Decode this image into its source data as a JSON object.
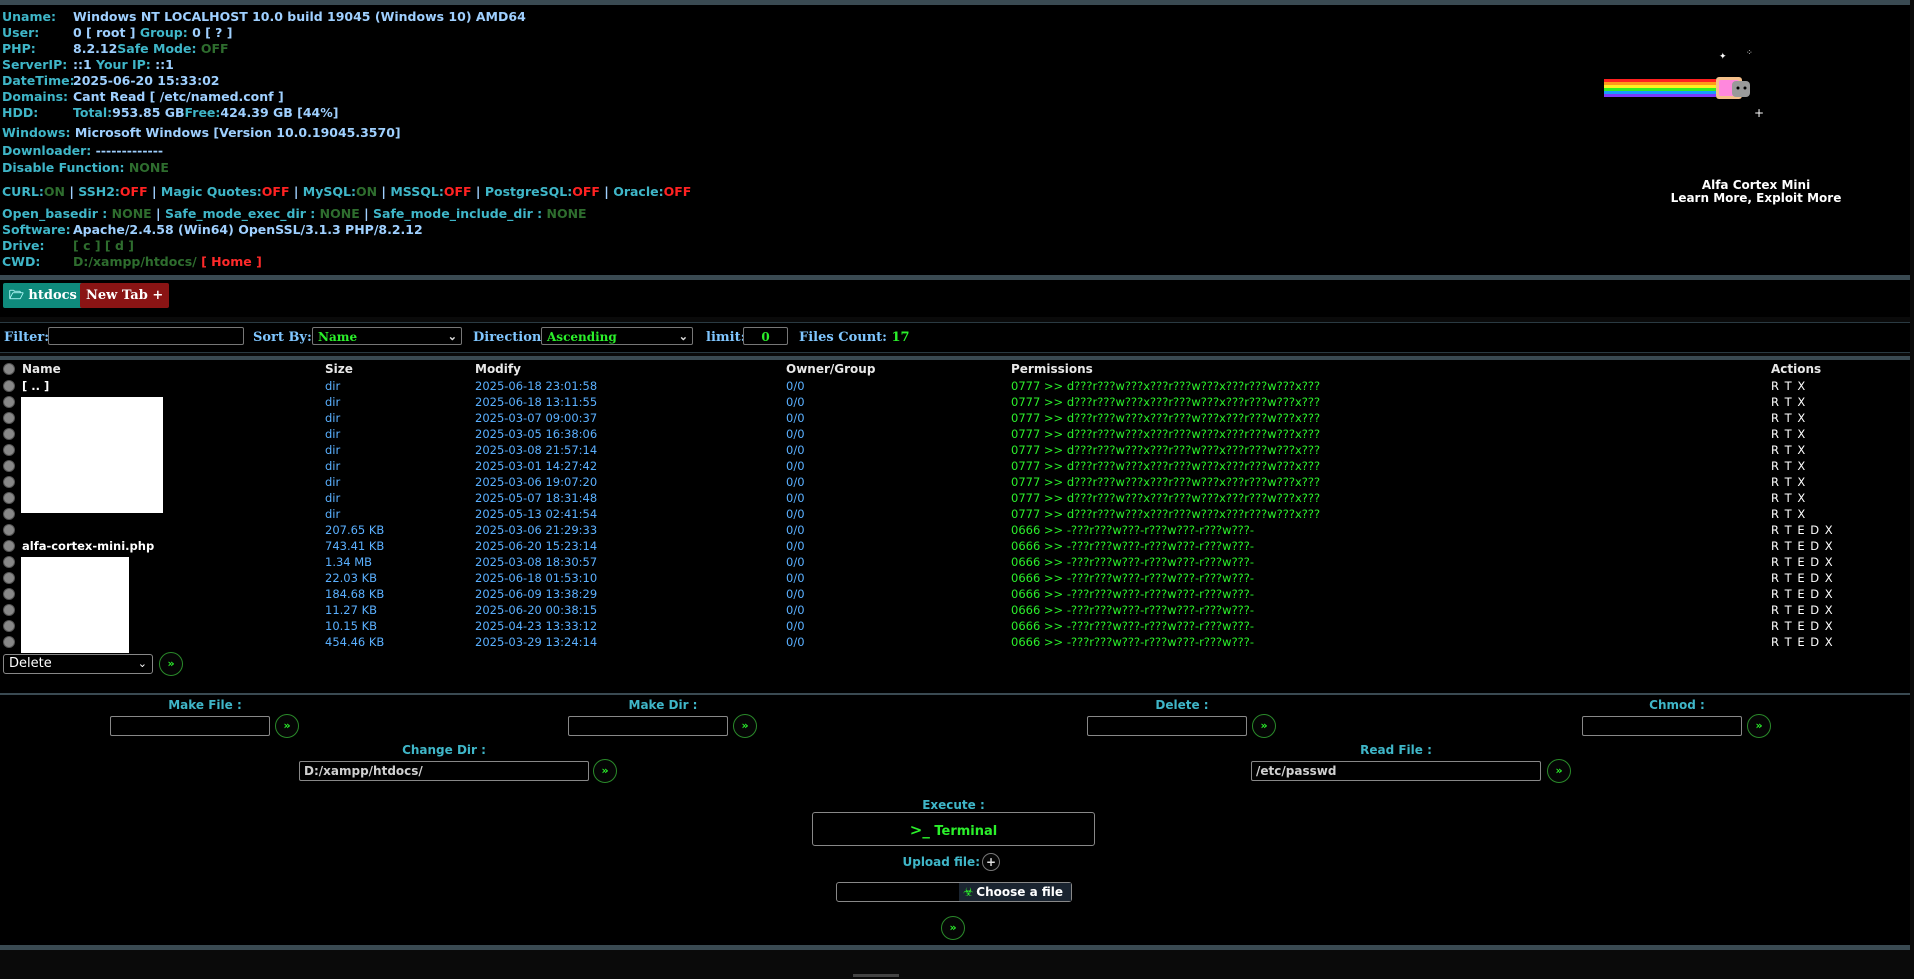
{
  "info": {
    "uname_label": "Uname:",
    "uname_value": "Windows NT LOCALHOST 10.0 build 19045 (Windows 10) AMD64",
    "user_label": "User:",
    "user_value": "0 [ root ] ",
    "group_label": "Group:",
    "group_value": " 0 [ ? ]",
    "php_label": "PHP:",
    "php_value": "8.2.12",
    "safe_mode_label": " Safe Mode:",
    "safe_mode_value": " OFF",
    "serverip_label": "ServerIP:",
    "serverip_value": "::1 ",
    "yourip_label": "Your IP:",
    "yourip_value": " ::1",
    "datetime_label": "DateTime:",
    "datetime_value": "2025-06-20 15:33:02",
    "domains_label": "Domains:",
    "domains_value": "Cant Read [ /etc/named.conf ]",
    "hdd_label": "HDD:",
    "hdd_total_label": "Total:",
    "hdd_total_value": "953.85 GB",
    "hdd_free_label": " Free:",
    "hdd_free_value": "424.39 GB [44%]",
    "windows_label": "Windows:",
    "windows_value": " Microsoft Windows [Version 10.0.19045.3570]",
    "downloader_label": "Downloader:",
    "downloader_value": " -------------",
    "disable_label": "Disable Function:",
    "disable_value": " NONE",
    "services": [
      {
        "name": "CURL",
        "state": "ON"
      },
      {
        "name": "SSH2",
        "state": "OFF"
      },
      {
        "name": "Magic Quotes",
        "state": "OFF"
      },
      {
        "name": "MySQL",
        "state": "ON"
      },
      {
        "name": "MSSQL",
        "state": "OFF"
      },
      {
        "name": "PostgreSQL",
        "state": "OFF"
      },
      {
        "name": "Oracle",
        "state": "OFF"
      }
    ],
    "open_basedir_label": "Open_basedir :",
    "open_basedir_value": " NONE",
    "safe_exec_label": "Safe_mode_exec_dir :",
    "safe_exec_value": " NONE",
    "safe_include_label": "Safe_mode_include_dir :",
    "safe_include_value": " NONE",
    "software_label": "Software:",
    "software_value": "Apache/2.4.58 (Win64) OpenSSL/3.1.3 PHP/8.2.12",
    "drive_label": "Drive:",
    "drive_value": "[ c ] [ d ]",
    "cwd_label": "CWD:",
    "cwd_value": "D:/xampp/htdocs/",
    "cwd_home": "[ Home ]"
  },
  "brand": {
    "title": "Alfa Cortex Mini",
    "tagline": "Learn More, Exploit More"
  },
  "tabs": [
    {
      "label": "htdocs",
      "icon": "folder-open-icon"
    },
    {
      "label": "New Tab",
      "icon": "plus-icon"
    }
  ],
  "filter": {
    "filter_label": "Filter:",
    "filter_value": "",
    "sort_label": "Sort By:",
    "sort_value": "Name",
    "direction_label": "Direction:",
    "direction_value": "Ascending",
    "limit_label": "limit:",
    "limit_value": "0",
    "count_label": "Files Count:",
    "count_value": "17"
  },
  "table": {
    "headers": {
      "name": "Name",
      "size": "Size",
      "modify": "Modify",
      "owner": "Owner/Group",
      "perms": "Permissions",
      "actions": "Actions"
    },
    "rows": [
      {
        "name": "[ .. ]",
        "size": "dir",
        "modify": "2025-06-18 23:01:58",
        "owner": "0/0",
        "perm": "0777 >> d???r???w???x???r???w???x???r???w???x???",
        "actions": "R T X"
      },
      {
        "name": "",
        "size": "dir",
        "modify": "2025-06-18 13:11:55",
        "owner": "0/0",
        "perm": "0777 >> d???r???w???x???r???w???x???r???w???x???",
        "actions": "R T X"
      },
      {
        "name": "",
        "size": "dir",
        "modify": "2025-03-07 09:00:37",
        "owner": "0/0",
        "perm": "0777 >> d???r???w???x???r???w???x???r???w???x???",
        "actions": "R T X"
      },
      {
        "name": "",
        "size": "dir",
        "modify": "2025-03-05 16:38:06",
        "owner": "0/0",
        "perm": "0777 >> d???r???w???x???r???w???x???r???w???x???",
        "actions": "R T X"
      },
      {
        "name": "",
        "size": "dir",
        "modify": "2025-03-08 21:57:14",
        "owner": "0/0",
        "perm": "0777 >> d???r???w???x???r???w???x???r???w???x???",
        "actions": "R T X"
      },
      {
        "name": "",
        "size": "dir",
        "modify": "2025-03-01 14:27:42",
        "owner": "0/0",
        "perm": "0777 >> d???r???w???x???r???w???x???r???w???x???",
        "actions": "R T X"
      },
      {
        "name": "",
        "size": "dir",
        "modify": "2025-03-06 19:07:20",
        "owner": "0/0",
        "perm": "0777 >> d???r???w???x???r???w???x???r???w???x???",
        "actions": "R T X"
      },
      {
        "name": "",
        "size": "dir",
        "modify": "2025-05-07 18:31:48",
        "owner": "0/0",
        "perm": "0777 >> d???r???w???x???r???w???x???r???w???x???",
        "actions": "R T X"
      },
      {
        "name": "",
        "size": "dir",
        "modify": "2025-05-13 02:41:54",
        "owner": "0/0",
        "perm": "0777 >> d???r???w???x???r???w???x???r???w???x???",
        "actions": "R T X"
      },
      {
        "name": "",
        "size": "207.65 KB",
        "modify": "2025-03-06 21:29:33",
        "owner": "0/0",
        "perm": "0666 >> -???r???w???-r???w???-r???w???-",
        "actions": "R T E D X"
      },
      {
        "name": "alfa-cortex-mini.php",
        "size": "743.41 KB",
        "modify": "2025-06-20 15:23:14",
        "owner": "0/0",
        "perm": "0666 >> -???r???w???-r???w???-r???w???-",
        "actions": "R T E D X"
      },
      {
        "name": "",
        "size": "1.34 MB",
        "modify": "2025-03-08 18:30:57",
        "owner": "0/0",
        "perm": "0666 >> -???r???w???-r???w???-r???w???-",
        "actions": "R T E D X"
      },
      {
        "name": "",
        "size": "22.03 KB",
        "modify": "2025-06-18 01:53:10",
        "owner": "0/0",
        "perm": "0666 >> -???r???w???-r???w???-r???w???-",
        "actions": "R T E D X"
      },
      {
        "name": "",
        "size": "184.68 KB",
        "modify": "2025-06-09 13:38:29",
        "owner": "0/0",
        "perm": "0666 >> -???r???w???-r???w???-r???w???-",
        "actions": "R T E D X"
      },
      {
        "name": "",
        "size": "11.27 KB",
        "modify": "2025-06-20 00:38:15",
        "owner": "0/0",
        "perm": "0666 >> -???r???w???-r???w???-r???w???-",
        "actions": "R T E D X"
      },
      {
        "name": "",
        "size": "10.15 KB",
        "modify": "2025-04-23 13:33:12",
        "owner": "0/0",
        "perm": "0666 >> -???r???w???-r???w???-r???w???-",
        "actions": "R T E D X"
      },
      {
        "name": "",
        "size": "454.46 KB",
        "modify": "2025-03-29 13:24:14",
        "owner": "0/0",
        "perm": "0666 >> -???r???w???-r???w???-r???w???-",
        "actions": "R T E D X"
      }
    ],
    "bulk_action": "Delete"
  },
  "tools": {
    "make_file_label": "Make File :",
    "make_file_value": "",
    "make_dir_label": "Make Dir :",
    "make_dir_value": "",
    "delete_label": "Delete :",
    "delete_value": "",
    "chmod_label": "Chmod :",
    "chmod_value": "",
    "change_dir_label": "Change Dir :",
    "change_dir_value": "D:/xampp/htdocs/",
    "read_file_label": "Read File :",
    "read_file_value": "/etc/passwd",
    "execute_label": "Execute :",
    "terminal_label": "Terminal",
    "upload_label": "Upload file:",
    "choose_file_label": "Choose a file"
  },
  "colors": {
    "accent_green": "#2bf02b",
    "accent_cyan": "#3fb6c8",
    "danger_red": "#ff2222",
    "link_blue": "#5ab0ff"
  }
}
